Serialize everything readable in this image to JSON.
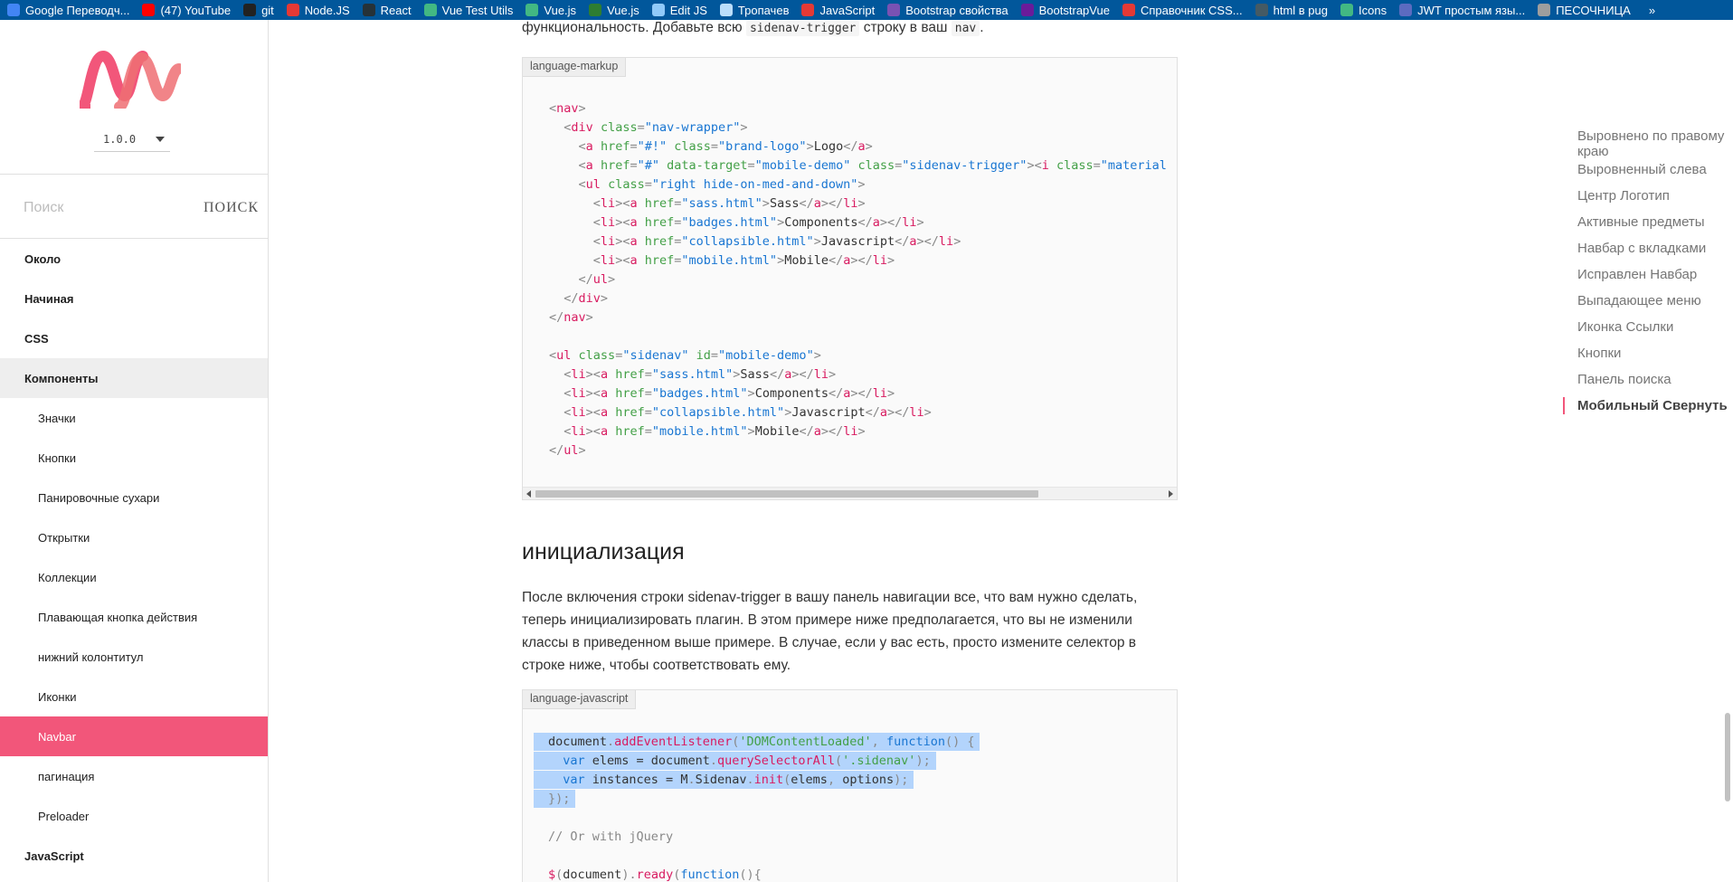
{
  "bookmarks": [
    {
      "label": "Google Переводч...",
      "icon": "google-translate-icon",
      "color": "#4285f4"
    },
    {
      "label": "(47) YouTube",
      "icon": "youtube-icon",
      "color": "#ff0000"
    },
    {
      "label": "git",
      "icon": "github-icon",
      "color": "#222222"
    },
    {
      "label": "Node.JS",
      "icon": "nodejs-icon",
      "color": "#e53935"
    },
    {
      "label": "React",
      "icon": "react-icon",
      "color": "#263238"
    },
    {
      "label": "Vue Test Utils",
      "icon": "vue-icon",
      "color": "#42b883"
    },
    {
      "label": "Vue.js",
      "icon": "vue-icon",
      "color": "#42b883"
    },
    {
      "label": "Vue.js",
      "icon": "vue-icon",
      "color": "#2e7d32"
    },
    {
      "label": "Edit JS",
      "icon": "file-icon",
      "color": "#90caf9"
    },
    {
      "label": "Тропачев",
      "icon": "document-icon",
      "color": "#bbdefb"
    },
    {
      "label": "JavaScript",
      "icon": "js-icon",
      "color": "#e53935"
    },
    {
      "label": "Bootstrap свойства",
      "icon": "bootstrap-icon",
      "color": "#7952b3"
    },
    {
      "label": "BootstrapVue",
      "icon": "bootstrapvue-icon",
      "color": "#6a1b9a"
    },
    {
      "label": "Справочник CSS...",
      "icon": "css-icon",
      "color": "#e53935"
    },
    {
      "label": "html в pug",
      "icon": "pug-icon",
      "color": "#455a64"
    },
    {
      "label": "Icons",
      "icon": "vue-icon",
      "color": "#42b883"
    },
    {
      "label": "JWT простым язы...",
      "icon": "jwt-icon",
      "color": "#5c6bc0"
    },
    {
      "label": "ПЕСОЧНИЦА",
      "icon": "sandbox-icon",
      "color": "#9e9e9e"
    }
  ],
  "bookmarks_more": "»",
  "sidebar": {
    "version": "1.0.0",
    "search_placeholder": "Поиск",
    "search_button": "ПОИСК",
    "brand_color": "#f2567a",
    "items_top": [
      {
        "label": "Около"
      },
      {
        "label": "Начиная"
      },
      {
        "label": "CSS"
      },
      {
        "label": "Компоненты"
      }
    ],
    "sub_items": [
      {
        "label": "Значки"
      },
      {
        "label": "Кнопки"
      },
      {
        "label": "Панировочные сухари"
      },
      {
        "label": "Открытки"
      },
      {
        "label": "Коллекции"
      },
      {
        "label": "Плавающая кнопка действия"
      },
      {
        "label": "нижний колонтитул"
      },
      {
        "label": "Иконки"
      },
      {
        "label": "Navbar"
      },
      {
        "label": "пагинация"
      },
      {
        "label": "Preloader"
      }
    ],
    "last_top": {
      "label": "JavaScript"
    }
  },
  "content": {
    "intro_prefix": "функциональность. Добавьте всю",
    "intro_code": "sidenav-trigger",
    "intro_middle": "строку в ваш",
    "intro_code2": "nav",
    "intro_suffix": ".",
    "block1_lang": "language-markup",
    "section_title": "инициализация",
    "paragraph": "После включения строки sidenav-trigger в вашу панель навигации все, что вам нужно сделать, теперь инициализировать плагин. В этом примере ниже предполагается, что вы не изменили классы в приведенном выше примере. В случае, если у вас есть, просто измените селектор в строке ниже, чтобы соответствовать ему.",
    "block2_lang": "language-javascript",
    "markup_lines": [
      [
        [
          "p",
          "<"
        ],
        [
          "t",
          "nav"
        ],
        [
          "p",
          ">"
        ]
      ],
      [
        [
          "x",
          "  "
        ],
        [
          "p",
          "<"
        ],
        [
          "t",
          "div"
        ],
        [
          "x",
          " "
        ],
        [
          "a",
          "class"
        ],
        [
          "p",
          "="
        ],
        [
          "v",
          "\"nav-wrapper\""
        ],
        [
          "p",
          ">"
        ]
      ],
      [
        [
          "x",
          "    "
        ],
        [
          "p",
          "<"
        ],
        [
          "t",
          "a"
        ],
        [
          "x",
          " "
        ],
        [
          "a",
          "href"
        ],
        [
          "p",
          "="
        ],
        [
          "v",
          "\"#!\""
        ],
        [
          "x",
          " "
        ],
        [
          "a",
          "class"
        ],
        [
          "p",
          "="
        ],
        [
          "v",
          "\"brand-logo\""
        ],
        [
          "p",
          ">"
        ],
        [
          "x",
          "Logo"
        ],
        [
          "p",
          "</"
        ],
        [
          "t",
          "a"
        ],
        [
          "p",
          ">"
        ]
      ],
      [
        [
          "x",
          "    "
        ],
        [
          "p",
          "<"
        ],
        [
          "t",
          "a"
        ],
        [
          "x",
          " "
        ],
        [
          "a",
          "href"
        ],
        [
          "p",
          "="
        ],
        [
          "v",
          "\"#\""
        ],
        [
          "x",
          " "
        ],
        [
          "a",
          "data-target"
        ],
        [
          "p",
          "="
        ],
        [
          "v",
          "\"mobile-demo\""
        ],
        [
          "x",
          " "
        ],
        [
          "a",
          "class"
        ],
        [
          "p",
          "="
        ],
        [
          "v",
          "\"sidenav-trigger\""
        ],
        [
          "p",
          ">"
        ],
        [
          "p",
          "<"
        ],
        [
          "t",
          "i"
        ],
        [
          "x",
          " "
        ],
        [
          "a",
          "class"
        ],
        [
          "p",
          "="
        ],
        [
          "v",
          "\"material"
        ]
      ],
      [
        [
          "x",
          "    "
        ],
        [
          "p",
          "<"
        ],
        [
          "t",
          "ul"
        ],
        [
          "x",
          " "
        ],
        [
          "a",
          "class"
        ],
        [
          "p",
          "="
        ],
        [
          "v",
          "\"right hide-on-med-and-down\""
        ],
        [
          "p",
          ">"
        ]
      ],
      [
        [
          "x",
          "      "
        ],
        [
          "p",
          "<"
        ],
        [
          "t",
          "li"
        ],
        [
          "p",
          "><"
        ],
        [
          "t",
          "a"
        ],
        [
          "x",
          " "
        ],
        [
          "a",
          "href"
        ],
        [
          "p",
          "="
        ],
        [
          "v",
          "\"sass.html\""
        ],
        [
          "p",
          ">"
        ],
        [
          "x",
          "Sass"
        ],
        [
          "p",
          "</"
        ],
        [
          "t",
          "a"
        ],
        [
          "p",
          "></"
        ],
        [
          "t",
          "li"
        ],
        [
          "p",
          ">"
        ]
      ],
      [
        [
          "x",
          "      "
        ],
        [
          "p",
          "<"
        ],
        [
          "t",
          "li"
        ],
        [
          "p",
          "><"
        ],
        [
          "t",
          "a"
        ],
        [
          "x",
          " "
        ],
        [
          "a",
          "href"
        ],
        [
          "p",
          "="
        ],
        [
          "v",
          "\"badges.html\""
        ],
        [
          "p",
          ">"
        ],
        [
          "x",
          "Components"
        ],
        [
          "p",
          "</"
        ],
        [
          "t",
          "a"
        ],
        [
          "p",
          "></"
        ],
        [
          "t",
          "li"
        ],
        [
          "p",
          ">"
        ]
      ],
      [
        [
          "x",
          "      "
        ],
        [
          "p",
          "<"
        ],
        [
          "t",
          "li"
        ],
        [
          "p",
          "><"
        ],
        [
          "t",
          "a"
        ],
        [
          "x",
          " "
        ],
        [
          "a",
          "href"
        ],
        [
          "p",
          "="
        ],
        [
          "v",
          "\"collapsible.html\""
        ],
        [
          "p",
          ">"
        ],
        [
          "x",
          "Javascript"
        ],
        [
          "p",
          "</"
        ],
        [
          "t",
          "a"
        ],
        [
          "p",
          "></"
        ],
        [
          "t",
          "li"
        ],
        [
          "p",
          ">"
        ]
      ],
      [
        [
          "x",
          "      "
        ],
        [
          "p",
          "<"
        ],
        [
          "t",
          "li"
        ],
        [
          "p",
          "><"
        ],
        [
          "t",
          "a"
        ],
        [
          "x",
          " "
        ],
        [
          "a",
          "href"
        ],
        [
          "p",
          "="
        ],
        [
          "v",
          "\"mobile.html\""
        ],
        [
          "p",
          ">"
        ],
        [
          "x",
          "Mobile"
        ],
        [
          "p",
          "</"
        ],
        [
          "t",
          "a"
        ],
        [
          "p",
          "></"
        ],
        [
          "t",
          "li"
        ],
        [
          "p",
          ">"
        ]
      ],
      [
        [
          "x",
          "    "
        ],
        [
          "p",
          "</"
        ],
        [
          "t",
          "ul"
        ],
        [
          "p",
          ">"
        ]
      ],
      [
        [
          "x",
          "  "
        ],
        [
          "p",
          "</"
        ],
        [
          "t",
          "div"
        ],
        [
          "p",
          ">"
        ]
      ],
      [
        [
          "p",
          "</"
        ],
        [
          "t",
          "nav"
        ],
        [
          "p",
          ">"
        ]
      ],
      [
        [
          "x",
          ""
        ]
      ],
      [
        [
          "p",
          "<"
        ],
        [
          "t",
          "ul"
        ],
        [
          "x",
          " "
        ],
        [
          "a",
          "class"
        ],
        [
          "p",
          "="
        ],
        [
          "v",
          "\"sidenav\""
        ],
        [
          "x",
          " "
        ],
        [
          "a",
          "id"
        ],
        [
          "p",
          "="
        ],
        [
          "v",
          "\"mobile-demo\""
        ],
        [
          "p",
          ">"
        ]
      ],
      [
        [
          "x",
          "  "
        ],
        [
          "p",
          "<"
        ],
        [
          "t",
          "li"
        ],
        [
          "p",
          "><"
        ],
        [
          "t",
          "a"
        ],
        [
          "x",
          " "
        ],
        [
          "a",
          "href"
        ],
        [
          "p",
          "="
        ],
        [
          "v",
          "\"sass.html\""
        ],
        [
          "p",
          ">"
        ],
        [
          "x",
          "Sass"
        ],
        [
          "p",
          "</"
        ],
        [
          "t",
          "a"
        ],
        [
          "p",
          "></"
        ],
        [
          "t",
          "li"
        ],
        [
          "p",
          ">"
        ]
      ],
      [
        [
          "x",
          "  "
        ],
        [
          "p",
          "<"
        ],
        [
          "t",
          "li"
        ],
        [
          "p",
          "><"
        ],
        [
          "t",
          "a"
        ],
        [
          "x",
          " "
        ],
        [
          "a",
          "href"
        ],
        [
          "p",
          "="
        ],
        [
          "v",
          "\"badges.html\""
        ],
        [
          "p",
          ">"
        ],
        [
          "x",
          "Components"
        ],
        [
          "p",
          "</"
        ],
        [
          "t",
          "a"
        ],
        [
          "p",
          "></"
        ],
        [
          "t",
          "li"
        ],
        [
          "p",
          ">"
        ]
      ],
      [
        [
          "x",
          "  "
        ],
        [
          "p",
          "<"
        ],
        [
          "t",
          "li"
        ],
        [
          "p",
          "><"
        ],
        [
          "t",
          "a"
        ],
        [
          "x",
          " "
        ],
        [
          "a",
          "href"
        ],
        [
          "p",
          "="
        ],
        [
          "v",
          "\"collapsible.html\""
        ],
        [
          "p",
          ">"
        ],
        [
          "x",
          "Javascript"
        ],
        [
          "p",
          "</"
        ],
        [
          "t",
          "a"
        ],
        [
          "p",
          "></"
        ],
        [
          "t",
          "li"
        ],
        [
          "p",
          ">"
        ]
      ],
      [
        [
          "x",
          "  "
        ],
        [
          "p",
          "<"
        ],
        [
          "t",
          "li"
        ],
        [
          "p",
          "><"
        ],
        [
          "t",
          "a"
        ],
        [
          "x",
          " "
        ],
        [
          "a",
          "href"
        ],
        [
          "p",
          "="
        ],
        [
          "v",
          "\"mobile.html\""
        ],
        [
          "p",
          ">"
        ],
        [
          "x",
          "Mobile"
        ],
        [
          "p",
          "</"
        ],
        [
          "t",
          "a"
        ],
        [
          "p",
          "></"
        ],
        [
          "t",
          "li"
        ],
        [
          "p",
          ">"
        ]
      ],
      [
        [
          "p",
          "</"
        ],
        [
          "t",
          "ul"
        ],
        [
          "p",
          ">"
        ]
      ]
    ],
    "js_lines": [
      {
        "sel": true,
        "tokens": [
          [
            "x",
            "document"
          ],
          [
            "p",
            "."
          ],
          [
            "f",
            "addEventListener"
          ],
          [
            "p",
            "("
          ],
          [
            "s",
            "'DOMContentLoaded'"
          ],
          [
            "p",
            ", "
          ],
          [
            "k",
            "function"
          ],
          [
            "p",
            "() {"
          ]
        ]
      },
      {
        "sel": true,
        "tokens": [
          [
            "x",
            "  "
          ],
          [
            "k",
            "var"
          ],
          [
            "x",
            " elems = document"
          ],
          [
            "p",
            "."
          ],
          [
            "f",
            "querySelectorAll"
          ],
          [
            "p",
            "("
          ],
          [
            "s",
            "'.sidenav'"
          ],
          [
            "p",
            ");"
          ]
        ]
      },
      {
        "sel": true,
        "tokens": [
          [
            "x",
            "  "
          ],
          [
            "k",
            "var"
          ],
          [
            "x",
            " instances = M"
          ],
          [
            "p",
            "."
          ],
          [
            "x",
            "Sidenav"
          ],
          [
            "p",
            "."
          ],
          [
            "f",
            "init"
          ],
          [
            "p",
            "("
          ],
          [
            "x",
            "elems"
          ],
          [
            "p",
            ", "
          ],
          [
            "x",
            "options"
          ],
          [
            "p",
            ");"
          ]
        ]
      },
      {
        "sel": true,
        "tokens": [
          [
            "p",
            "});"
          ]
        ]
      },
      {
        "sel": false,
        "tokens": [
          [
            "x",
            ""
          ]
        ]
      },
      {
        "sel": false,
        "tokens": [
          [
            "c",
            "// Or with jQuery"
          ]
        ]
      },
      {
        "sel": false,
        "tokens": [
          [
            "x",
            ""
          ]
        ]
      },
      {
        "sel": false,
        "tokens": [
          [
            "f",
            "$"
          ],
          [
            "p",
            "("
          ],
          [
            "x",
            "document"
          ],
          [
            "p",
            ")."
          ],
          [
            "f",
            "ready"
          ],
          [
            "p",
            "("
          ],
          [
            "k",
            "function"
          ],
          [
            "p",
            "(){"
          ]
        ]
      }
    ]
  },
  "toc": [
    {
      "label": "Выровнено по правому краю"
    },
    {
      "label": "Выровненный слева"
    },
    {
      "label": "Центр Логотип"
    },
    {
      "label": "Активные предметы"
    },
    {
      "label": "Навбар с вкладками"
    },
    {
      "label": "Исправлен Навбар"
    },
    {
      "label": "Выпадающее меню"
    },
    {
      "label": "Иконка Ссылки"
    },
    {
      "label": "Кнопки"
    },
    {
      "label": "Панель поиска"
    },
    {
      "label": "Мобильный Свернуть",
      "active": true
    }
  ]
}
